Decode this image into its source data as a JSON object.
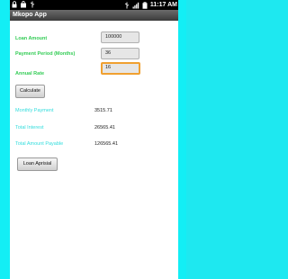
{
  "status_bar": {
    "time": "11:17 AM",
    "left_icons": [
      "lock-icon",
      "shopping-bag-icon",
      "usb-icon"
    ],
    "right_icons": [
      "usb-icon",
      "signal-icon",
      "battery-icon"
    ]
  },
  "app": {
    "title": "Mkopo App"
  },
  "form": {
    "loan_amount": {
      "label": "Loan Amount",
      "value": "100000"
    },
    "payment_period": {
      "label": "Payment Period (Months)",
      "value": "36"
    },
    "annual_rate": {
      "label": "Annual Rate",
      "value": "16"
    }
  },
  "actions": {
    "calculate_label": "Calculate",
    "appraisal_label": "Loan Aprisial"
  },
  "results": {
    "monthly_payment": {
      "label": "Monthly Payment",
      "value": "3515.71"
    },
    "total_interest": {
      "label": "Total Interest",
      "value": "26565.41"
    },
    "total_amount": {
      "label": "Total Amount Payable",
      "value": "126565.41"
    }
  },
  "colors": {
    "form_label": "#33cc55",
    "result_label": "#33dddd",
    "frame": "#13eef5",
    "focus": "#f0a030"
  }
}
